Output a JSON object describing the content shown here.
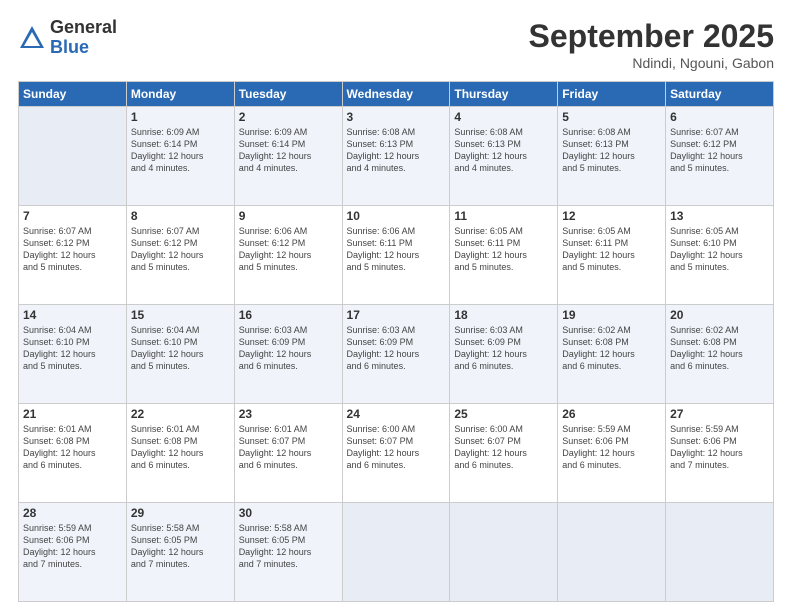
{
  "logo": {
    "general": "General",
    "blue": "Blue"
  },
  "title": "September 2025",
  "subtitle": "Ndindi, Ngouni, Gabon",
  "days_of_week": [
    "Sunday",
    "Monday",
    "Tuesday",
    "Wednesday",
    "Thursday",
    "Friday",
    "Saturday"
  ],
  "weeks": [
    [
      {
        "day": "",
        "info": ""
      },
      {
        "day": "1",
        "info": "Sunrise: 6:09 AM\nSunset: 6:14 PM\nDaylight: 12 hours\nand 4 minutes."
      },
      {
        "day": "2",
        "info": "Sunrise: 6:09 AM\nSunset: 6:14 PM\nDaylight: 12 hours\nand 4 minutes."
      },
      {
        "day": "3",
        "info": "Sunrise: 6:08 AM\nSunset: 6:13 PM\nDaylight: 12 hours\nand 4 minutes."
      },
      {
        "day": "4",
        "info": "Sunrise: 6:08 AM\nSunset: 6:13 PM\nDaylight: 12 hours\nand 4 minutes."
      },
      {
        "day": "5",
        "info": "Sunrise: 6:08 AM\nSunset: 6:13 PM\nDaylight: 12 hours\nand 5 minutes."
      },
      {
        "day": "6",
        "info": "Sunrise: 6:07 AM\nSunset: 6:12 PM\nDaylight: 12 hours\nand 5 minutes."
      }
    ],
    [
      {
        "day": "7",
        "info": "Sunrise: 6:07 AM\nSunset: 6:12 PM\nDaylight: 12 hours\nand 5 minutes."
      },
      {
        "day": "8",
        "info": "Sunrise: 6:07 AM\nSunset: 6:12 PM\nDaylight: 12 hours\nand 5 minutes."
      },
      {
        "day": "9",
        "info": "Sunrise: 6:06 AM\nSunset: 6:12 PM\nDaylight: 12 hours\nand 5 minutes."
      },
      {
        "day": "10",
        "info": "Sunrise: 6:06 AM\nSunset: 6:11 PM\nDaylight: 12 hours\nand 5 minutes."
      },
      {
        "day": "11",
        "info": "Sunrise: 6:05 AM\nSunset: 6:11 PM\nDaylight: 12 hours\nand 5 minutes."
      },
      {
        "day": "12",
        "info": "Sunrise: 6:05 AM\nSunset: 6:11 PM\nDaylight: 12 hours\nand 5 minutes."
      },
      {
        "day": "13",
        "info": "Sunrise: 6:05 AM\nSunset: 6:10 PM\nDaylight: 12 hours\nand 5 minutes."
      }
    ],
    [
      {
        "day": "14",
        "info": "Sunrise: 6:04 AM\nSunset: 6:10 PM\nDaylight: 12 hours\nand 5 minutes."
      },
      {
        "day": "15",
        "info": "Sunrise: 6:04 AM\nSunset: 6:10 PM\nDaylight: 12 hours\nand 5 minutes."
      },
      {
        "day": "16",
        "info": "Sunrise: 6:03 AM\nSunset: 6:09 PM\nDaylight: 12 hours\nand 6 minutes."
      },
      {
        "day": "17",
        "info": "Sunrise: 6:03 AM\nSunset: 6:09 PM\nDaylight: 12 hours\nand 6 minutes."
      },
      {
        "day": "18",
        "info": "Sunrise: 6:03 AM\nSunset: 6:09 PM\nDaylight: 12 hours\nand 6 minutes."
      },
      {
        "day": "19",
        "info": "Sunrise: 6:02 AM\nSunset: 6:08 PM\nDaylight: 12 hours\nand 6 minutes."
      },
      {
        "day": "20",
        "info": "Sunrise: 6:02 AM\nSunset: 6:08 PM\nDaylight: 12 hours\nand 6 minutes."
      }
    ],
    [
      {
        "day": "21",
        "info": "Sunrise: 6:01 AM\nSunset: 6:08 PM\nDaylight: 12 hours\nand 6 minutes."
      },
      {
        "day": "22",
        "info": "Sunrise: 6:01 AM\nSunset: 6:08 PM\nDaylight: 12 hours\nand 6 minutes."
      },
      {
        "day": "23",
        "info": "Sunrise: 6:01 AM\nSunset: 6:07 PM\nDaylight: 12 hours\nand 6 minutes."
      },
      {
        "day": "24",
        "info": "Sunrise: 6:00 AM\nSunset: 6:07 PM\nDaylight: 12 hours\nand 6 minutes."
      },
      {
        "day": "25",
        "info": "Sunrise: 6:00 AM\nSunset: 6:07 PM\nDaylight: 12 hours\nand 6 minutes."
      },
      {
        "day": "26",
        "info": "Sunrise: 5:59 AM\nSunset: 6:06 PM\nDaylight: 12 hours\nand 6 minutes."
      },
      {
        "day": "27",
        "info": "Sunrise: 5:59 AM\nSunset: 6:06 PM\nDaylight: 12 hours\nand 7 minutes."
      }
    ],
    [
      {
        "day": "28",
        "info": "Sunrise: 5:59 AM\nSunset: 6:06 PM\nDaylight: 12 hours\nand 7 minutes."
      },
      {
        "day": "29",
        "info": "Sunrise: 5:58 AM\nSunset: 6:05 PM\nDaylight: 12 hours\nand 7 minutes."
      },
      {
        "day": "30",
        "info": "Sunrise: 5:58 AM\nSunset: 6:05 PM\nDaylight: 12 hours\nand 7 minutes."
      },
      {
        "day": "",
        "info": ""
      },
      {
        "day": "",
        "info": ""
      },
      {
        "day": "",
        "info": ""
      },
      {
        "day": "",
        "info": ""
      }
    ]
  ]
}
